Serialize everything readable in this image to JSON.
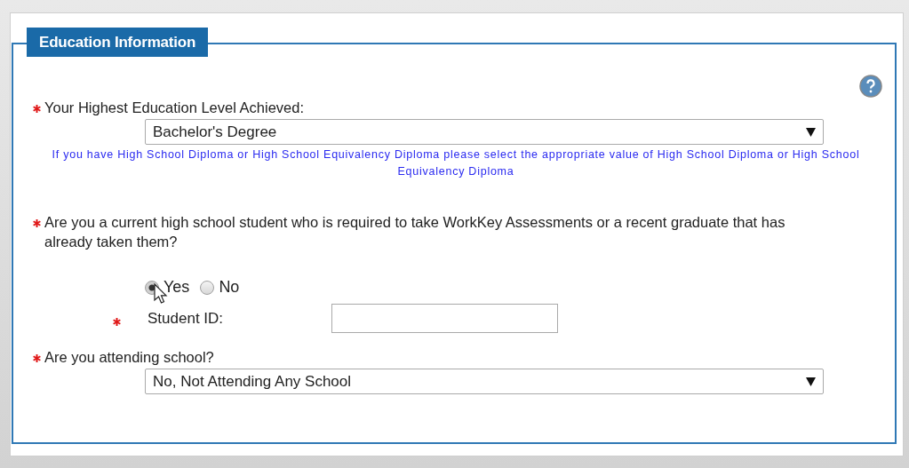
{
  "section": {
    "title": "Education Information"
  },
  "education_level": {
    "label": "Your Highest Education Level Achieved:",
    "required": true,
    "value": "Bachelor's Degree",
    "hint": "If you have High School Diploma or High School Equivalency Diploma please select the appropriate value of High School Diploma or High School Equivalency Diploma"
  },
  "workkey_question": {
    "label": "Are you a current high school student who is required to take WorkKey Assessments or a recent graduate that has already taken them?",
    "required": true,
    "options": [
      {
        "label": "Yes",
        "selected": true
      },
      {
        "label": "No",
        "selected": false
      }
    ]
  },
  "student_id": {
    "label": "Student ID:",
    "required": true
  },
  "attending_school": {
    "label": "Are you attending school?",
    "required": true,
    "value": "No, Not Attending Any School"
  }
}
